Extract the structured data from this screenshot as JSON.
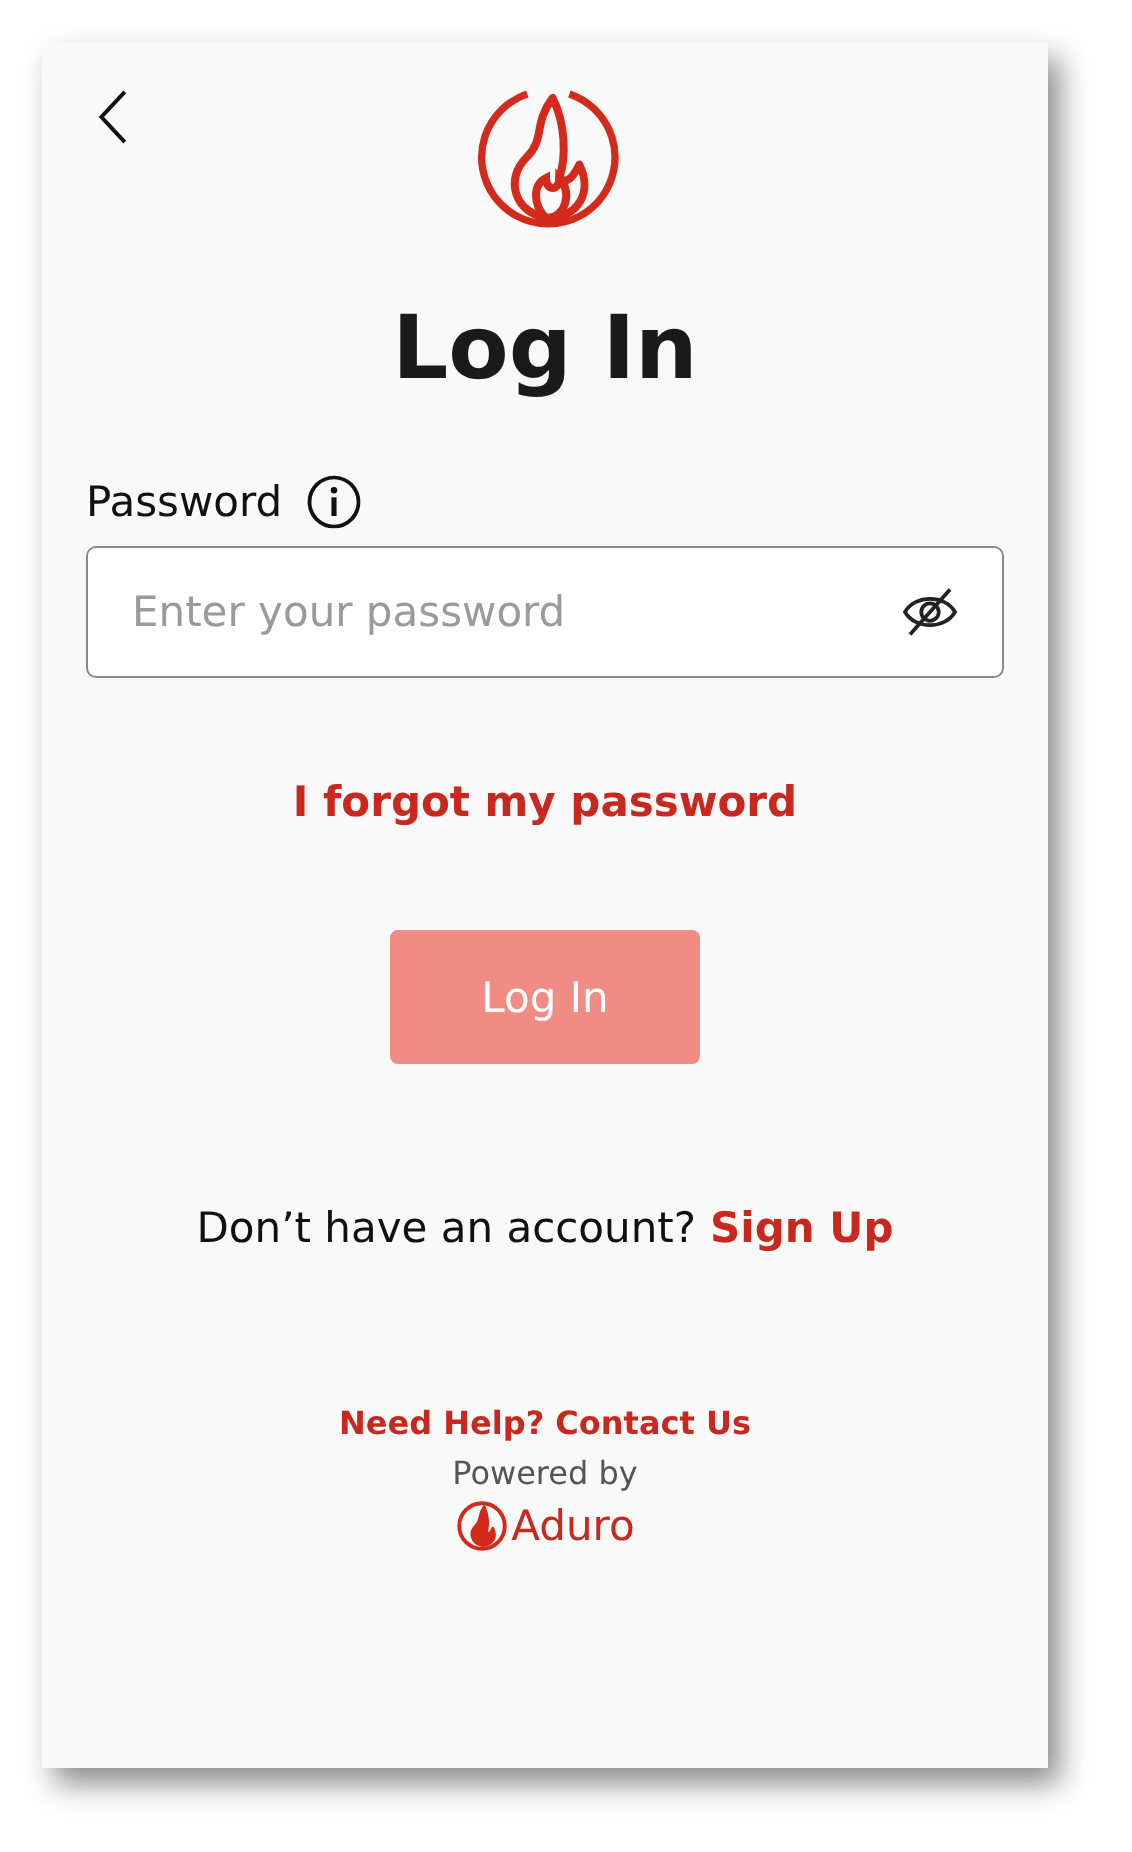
{
  "title": "Log In",
  "password": {
    "label": "Password",
    "placeholder": "Enter your password",
    "masked": true
  },
  "forgot_link": "I forgot my password",
  "login_button": {
    "label": "Log In",
    "disabled": true
  },
  "signup": {
    "prompt": "Don’t have an account?",
    "link": "Sign Up"
  },
  "help_link": "Need Help? Contact Us",
  "powered_by": "Powered by",
  "brand": "Aduro"
}
